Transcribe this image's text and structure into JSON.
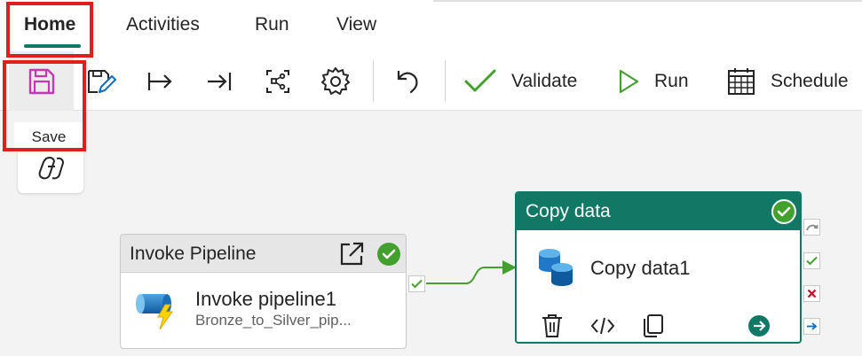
{
  "tabs": [
    {
      "label": "Home",
      "active": true
    },
    {
      "label": "Activities",
      "active": false
    },
    {
      "label": "Run",
      "active": false
    },
    {
      "label": "View",
      "active": false
    }
  ],
  "toolbar": {
    "buttons": [
      {
        "name": "save",
        "icon": "save-icon"
      },
      {
        "name": "edit-save-as",
        "icon": "edit-icon"
      },
      {
        "name": "export",
        "icon": "export-arrow-icon"
      },
      {
        "name": "import",
        "icon": "import-arrow-icon"
      },
      {
        "name": "view-dependencies",
        "icon": "graph-icon"
      },
      {
        "name": "settings",
        "icon": "gear-icon"
      },
      {
        "name": "undo",
        "icon": "undo-icon"
      }
    ],
    "validate_label": "Validate",
    "run_label": "Run",
    "schedule_label": "Schedule"
  },
  "tooltip": {
    "text": "Save"
  },
  "copilot": {
    "icon": "copilot-icon"
  },
  "canvas": {
    "invoke_activity": {
      "header": "Invoke Pipeline",
      "name": "Invoke pipeline1",
      "subtitle": "Bronze_to_Silver_pip...",
      "status": "succeeded"
    },
    "copy_activity": {
      "header": "Copy data",
      "name": "Copy data1",
      "status": "succeeded"
    }
  },
  "colors": {
    "accent": "#117865",
    "success": "#43a02f",
    "failure": "#c50f1f",
    "highlight": "#e01e1e",
    "completion": "#0f6cbd",
    "save_icon": "#c239b3"
  }
}
